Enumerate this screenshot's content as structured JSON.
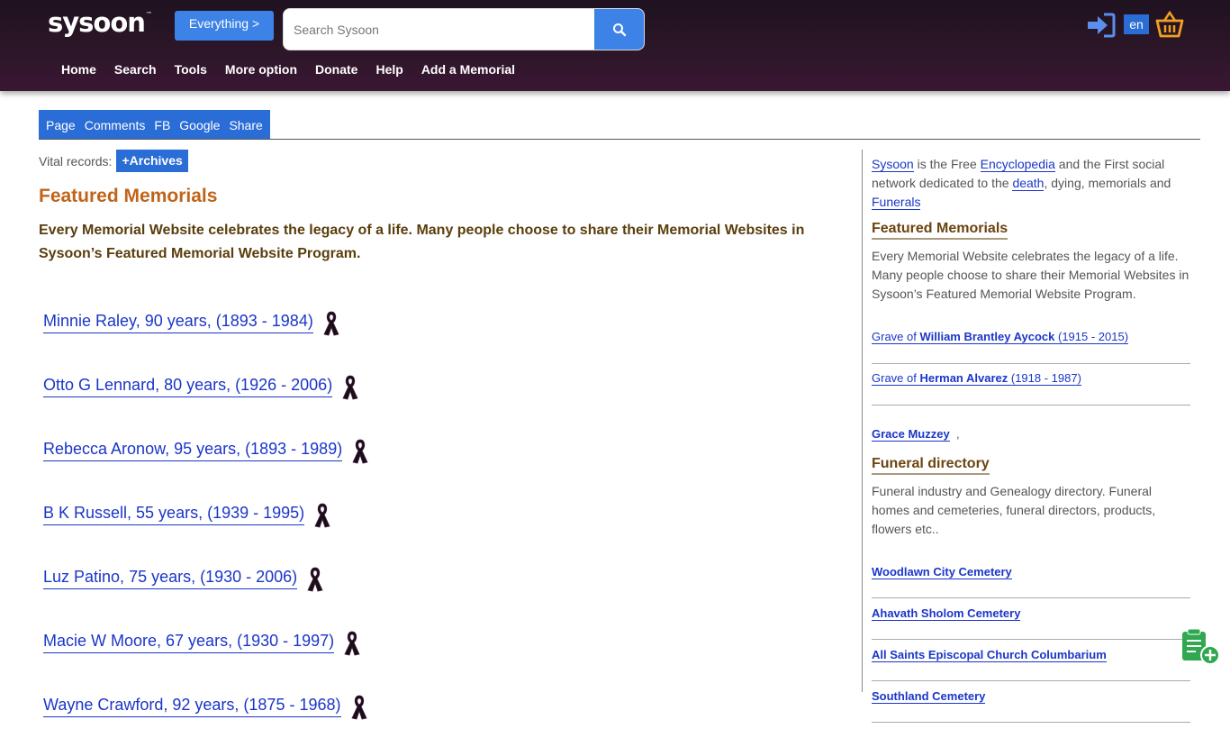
{
  "header": {
    "logo": "sysoon",
    "logo_tm": "™",
    "everything_label": "Everything >",
    "search_placeholder": "Search Sysoon",
    "lang": "en"
  },
  "nav": [
    "Home",
    "Search",
    "Tools",
    "More option",
    "Donate",
    "Help",
    "Add a Memorial"
  ],
  "tabs": [
    "Page",
    "Comments",
    "FB",
    "Google",
    "Share"
  ],
  "vital": {
    "label": "Vital records:",
    "button": "+Archives"
  },
  "main": {
    "title": "Featured Memorials",
    "description": "Every Memorial Website celebrates the legacy of a life. Many people choose to share their Memorial Websites in Sysoon’s Featured Memorial Website Program.",
    "memorials": [
      "Minnie Raley, 90 years, (1893 - 1984)",
      "Otto G Lennard, 80 years, (1926 - 2006)",
      "Rebecca Aronow, 95 years, (1893 - 1989)",
      "B K Russell, 55 years, (1939 - 1995)",
      "Luz Patino, 75 years, (1930 - 2006)",
      "Macie W Moore, 67 years, (1930 - 1997)",
      "Wayne Crawford, 92 years, (1875 - 1968)"
    ]
  },
  "sidebar": {
    "intro": {
      "sysoon": "Sysoon",
      "t1": " is the Free ",
      "encyclopedia": "Encyclopedia",
      "t2": " and the First social network dedicated to the ",
      "death": "death",
      "t3": ", dying, memorials and ",
      "funerals": "Funerals"
    },
    "featured_title": "Featured Memorials",
    "featured_text": "Every Memorial Website celebrates the legacy of a life. Many people choose to share their Memorial Websites in Sysoon’s Featured Memorial Website Program.",
    "graves": [
      {
        "prefix": "Grave of ",
        "name": "William Brantley Aycock",
        "years": " (1915 - 2015)"
      },
      {
        "prefix": "Grave of ",
        "name": "Herman Alvarez",
        "years": " (1918 - 1987)"
      }
    ],
    "grace": "Grace Muzzey",
    "grace_suffix": ",",
    "funeral_title": "Funeral directory",
    "funeral_text": "Funeral industry and Genealogy directory. Funeral homes and cemeteries, funeral directors, products, flowers etc..",
    "cemeteries": [
      "Woodlawn City Cemetery",
      "Ahavath Sholom Cemetery",
      "All Saints Episcopal Church Columbarium",
      "Southland Cemetery"
    ]
  }
}
